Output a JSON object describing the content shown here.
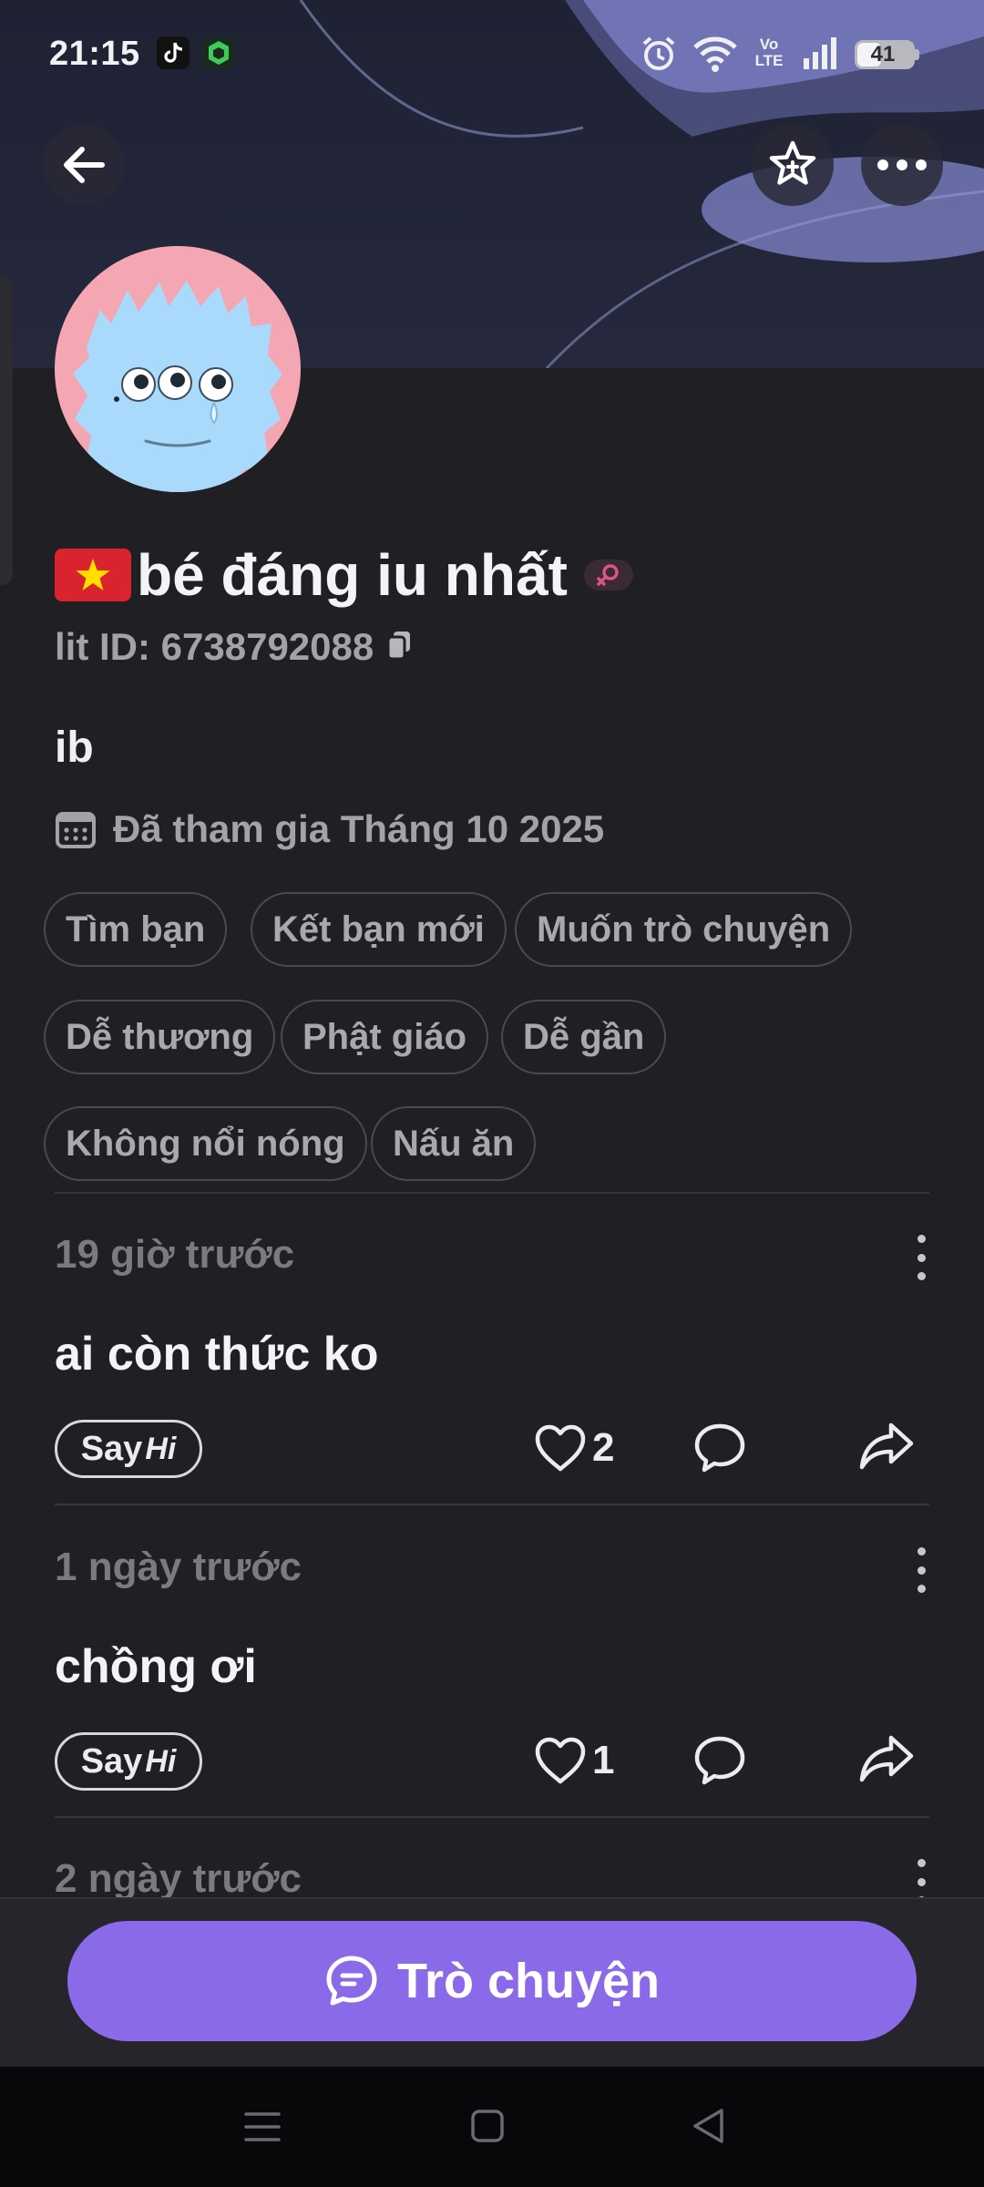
{
  "status_bar": {
    "time": "21:15",
    "battery_level": "41",
    "network_label": "Vo LTE",
    "icons": [
      "tiktok-icon",
      "app-shield-icon",
      "alarm-icon",
      "wifi-icon",
      "volte-icon",
      "signal-icon",
      "battery-icon"
    ]
  },
  "header": {
    "back_icon": "arrow-left-icon",
    "favorite_icon": "star-add-icon",
    "more_icon": "more-horizontal-icon"
  },
  "profile": {
    "flag": "vietnam-flag",
    "display_name": "bé đáng iu nhất",
    "gender_icon": "female-icon",
    "lit_id": "lit ID: 6738792088",
    "bio": "ib",
    "joined": "Đã tham gia Tháng 10 2025"
  },
  "tags": [
    "Tìm bạn",
    "Kết bạn mới",
    "Muốn trò chuyện",
    "Dễ thương",
    "Phật giáo",
    "Dễ gần",
    "Không nổi nóng",
    "Nấu ăn"
  ],
  "posts": [
    {
      "time": "19 giờ trước",
      "text": "ai còn thức ko",
      "likes": "2",
      "say": "Say",
      "hi": "Hi"
    },
    {
      "time": "1 ngày trước",
      "text": "chồng ơi",
      "likes": "1",
      "say": "Say",
      "hi": "Hi"
    },
    {
      "time": "2 ngày trước"
    }
  ],
  "chat_button": {
    "label": "Trò chuyện",
    "icon": "chat-bubble-icon"
  },
  "colors": {
    "accent": "#8a6ae8",
    "background": "#201f24",
    "avatar_bg": "#f4a7b3",
    "avatar_monster": "#a9d9fb"
  }
}
